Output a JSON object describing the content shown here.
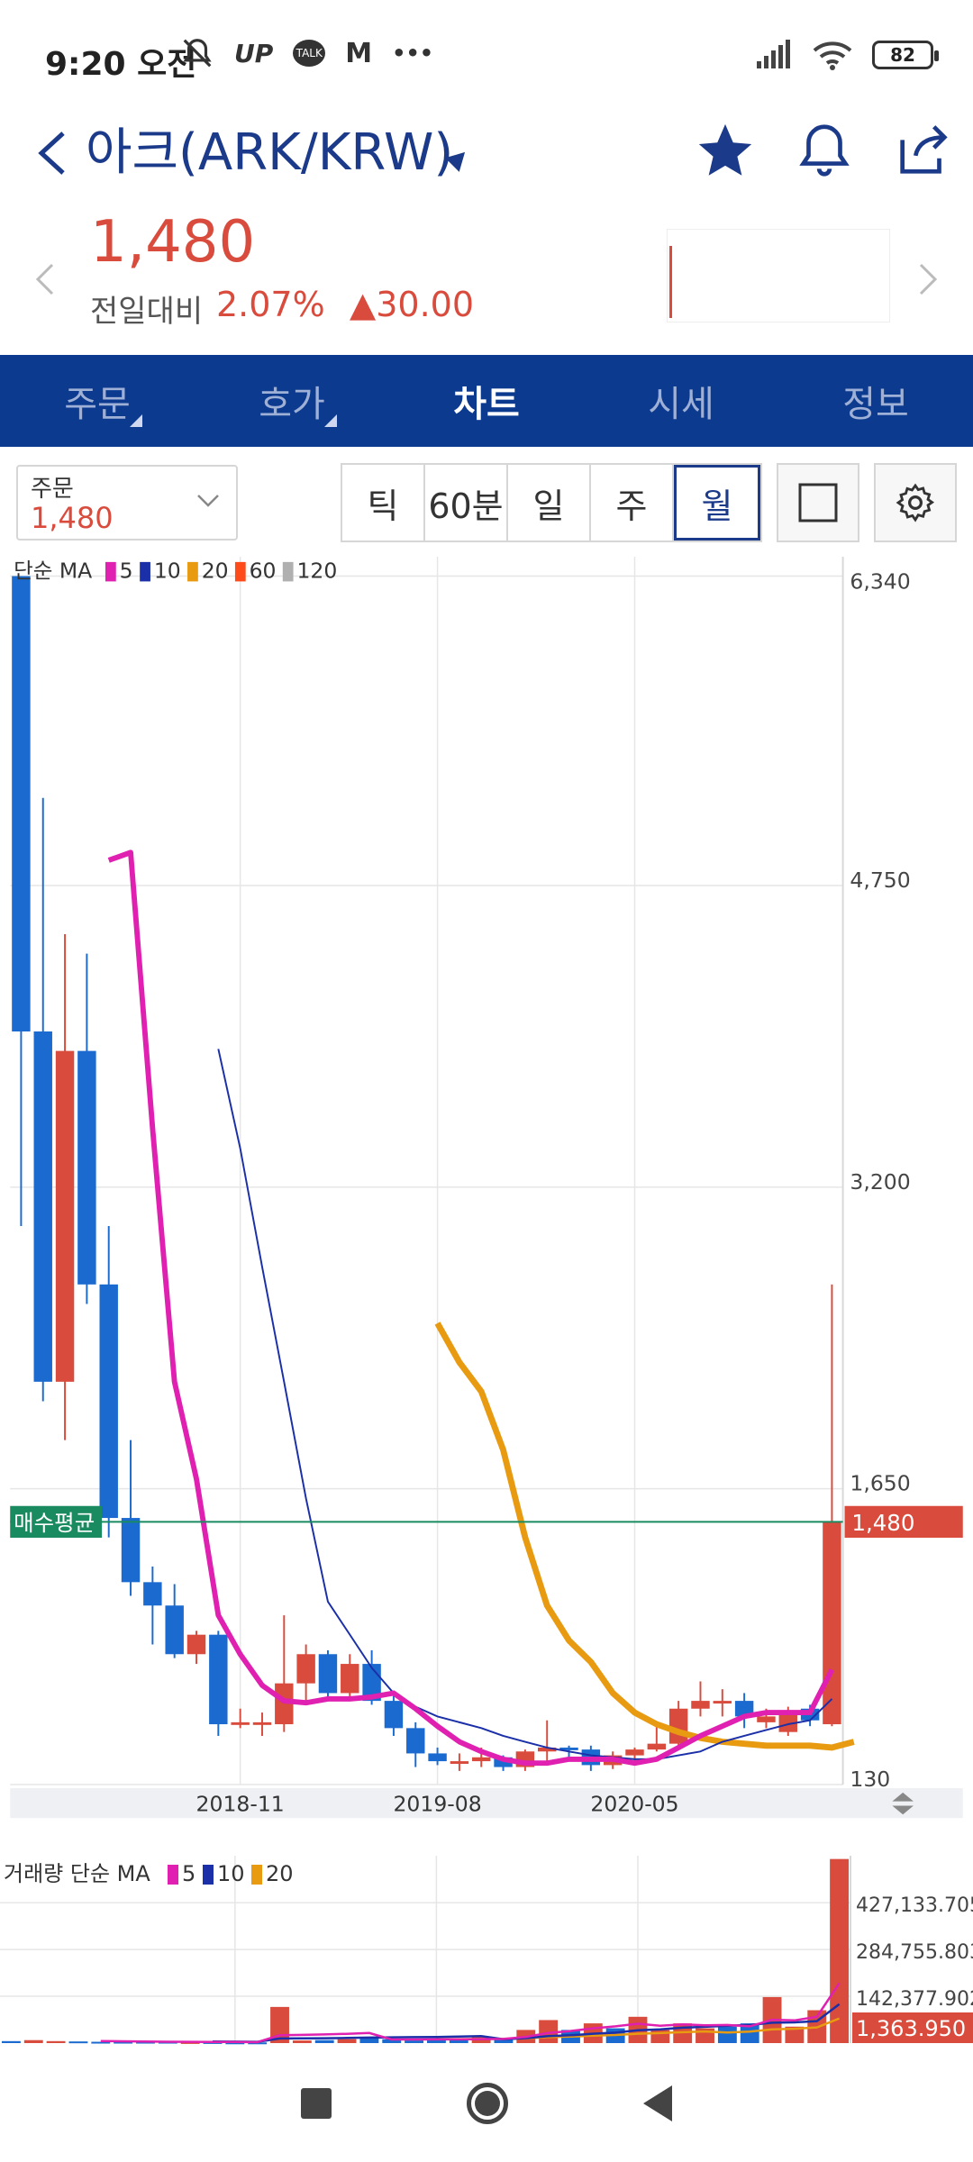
{
  "status_bar": {
    "time": "9:20 오전",
    "icons": [
      "bell-off-icon",
      "up-icon",
      "talk-icon",
      "m-icon",
      "more-icon"
    ],
    "icon_text_up": "UP",
    "icon_text_talk": "TALK",
    "icon_text_m": "M",
    "icon_text_more": "•••",
    "battery": "82"
  },
  "header": {
    "title": "아크(ARK/KRW)"
  },
  "price": {
    "current": "1,480",
    "change_label": "전일대비",
    "change_pct": "2.07%",
    "change_amt": "▲30.00",
    "color_up": "#d94b3c"
  },
  "tabs": [
    {
      "label": "주문"
    },
    {
      "label": "호가"
    },
    {
      "label": "차트"
    },
    {
      "label": "시세"
    },
    {
      "label": "정보"
    }
  ],
  "toolbar": {
    "order_label": "주문",
    "order_value": "1,480",
    "periods": [
      "틱",
      "60분",
      "일",
      "주",
      "월"
    ],
    "selected_period": "월"
  },
  "chart_data": [
    {
      "type": "candlestick",
      "legend": {
        "title": "단순 MA",
        "items": [
          {
            "label": "5",
            "color": "#e020b0"
          },
          {
            "label": "10",
            "color": "#1a2fa8"
          },
          {
            "label": "20",
            "color": "#e89a10"
          },
          {
            "label": "60",
            "color": "#ff4a1a"
          },
          {
            "label": "120",
            "color": "#b0b0b0"
          }
        ]
      },
      "y_ticks": [
        "6,340",
        "4,750",
        "3,200",
        "1,650",
        "130"
      ],
      "ylim": [
        130,
        6340
      ],
      "x_ticks": [
        {
          "label": "2018-11",
          "index": 10
        },
        {
          "label": "2019-08",
          "index": 19
        },
        {
          "label": "2020-05",
          "index": 28
        }
      ],
      "avg_buy_label": "매수평균",
      "current_price_label": "1,480",
      "current_price": 1480,
      "colors": {
        "up": "#d94b3c",
        "down": "#1a6ad0",
        "avg_line": "#1a8a60"
      },
      "candles": [
        {
          "o": 6340,
          "h": 6340,
          "l": 3000,
          "c": 4000
        },
        {
          "o": 4000,
          "h": 5200,
          "l": 2100,
          "c": 2200
        },
        {
          "o": 2200,
          "h": 4500,
          "l": 1900,
          "c": 3900
        },
        {
          "o": 3900,
          "h": 4400,
          "l": 2600,
          "c": 2700
        },
        {
          "o": 2700,
          "h": 3000,
          "l": 1400,
          "c": 1500
        },
        {
          "o": 1500,
          "h": 1900,
          "l": 1100,
          "c": 1170
        },
        {
          "o": 1170,
          "h": 1250,
          "l": 850,
          "c": 1050
        },
        {
          "o": 1050,
          "h": 1160,
          "l": 780,
          "c": 800
        },
        {
          "o": 800,
          "h": 920,
          "l": 750,
          "c": 900
        },
        {
          "o": 900,
          "h": 920,
          "l": 380,
          "c": 440
        },
        {
          "o": 440,
          "h": 520,
          "l": 420,
          "c": 450
        },
        {
          "o": 450,
          "h": 500,
          "l": 380,
          "c": 450
        },
        {
          "o": 440,
          "h": 1000,
          "l": 400,
          "c": 650
        },
        {
          "o": 650,
          "h": 850,
          "l": 550,
          "c": 800
        },
        {
          "o": 800,
          "h": 820,
          "l": 570,
          "c": 600
        },
        {
          "o": 600,
          "h": 800,
          "l": 580,
          "c": 750
        },
        {
          "o": 750,
          "h": 820,
          "l": 540,
          "c": 560
        },
        {
          "o": 560,
          "h": 600,
          "l": 380,
          "c": 420
        },
        {
          "o": 420,
          "h": 450,
          "l": 220,
          "c": 290
        },
        {
          "o": 290,
          "h": 320,
          "l": 230,
          "c": 250
        },
        {
          "o": 250,
          "h": 290,
          "l": 200,
          "c": 250
        },
        {
          "o": 250,
          "h": 320,
          "l": 220,
          "c": 270
        },
        {
          "o": 270,
          "h": 280,
          "l": 200,
          "c": 220
        },
        {
          "o": 220,
          "h": 310,
          "l": 200,
          "c": 300
        },
        {
          "o": 300,
          "h": 460,
          "l": 250,
          "c": 320
        },
        {
          "o": 320,
          "h": 330,
          "l": 260,
          "c": 310
        },
        {
          "o": 310,
          "h": 330,
          "l": 200,
          "c": 230
        },
        {
          "o": 230,
          "h": 300,
          "l": 210,
          "c": 280
        },
        {
          "o": 280,
          "h": 320,
          "l": 250,
          "c": 310
        },
        {
          "o": 310,
          "h": 440,
          "l": 300,
          "c": 340
        },
        {
          "o": 340,
          "h": 560,
          "l": 320,
          "c": 520
        },
        {
          "o": 520,
          "h": 660,
          "l": 480,
          "c": 560
        },
        {
          "o": 560,
          "h": 620,
          "l": 480,
          "c": 560
        },
        {
          "o": 560,
          "h": 600,
          "l": 420,
          "c": 480
        },
        {
          "o": 450,
          "h": 520,
          "l": 420,
          "c": 480
        },
        {
          "o": 400,
          "h": 530,
          "l": 380,
          "c": 500
        },
        {
          "o": 520,
          "h": 540,
          "l": 430,
          "c": 460
        },
        {
          "o": 440,
          "h": 2700,
          "l": 430,
          "c": 1480
        }
      ],
      "ma5": [
        null,
        null,
        null,
        null,
        4880,
        4920,
        3500,
        2200,
        1700,
        1000,
        800,
        640,
        560,
        550,
        570,
        570,
        580,
        600,
        520,
        430,
        350,
        300,
        260,
        240,
        240,
        260,
        260,
        260,
        240,
        260,
        320,
        380,
        430,
        480,
        500,
        500,
        500,
        720
      ],
      "ma10": [
        null,
        null,
        null,
        null,
        null,
        null,
        null,
        null,
        null,
        3910,
        3400,
        2790,
        2200,
        1600,
        1070,
        900,
        730,
        600,
        530,
        480,
        450,
        420,
        380,
        350,
        320,
        300,
        280,
        270,
        260,
        260,
        280,
        300,
        350,
        380,
        410,
        440,
        460,
        570
      ],
      "ma20": [
        null,
        null,
        null,
        null,
        null,
        null,
        null,
        null,
        null,
        null,
        null,
        null,
        null,
        null,
        null,
        null,
        null,
        null,
        null,
        2500,
        2300,
        2150,
        1850,
        1400,
        1050,
        870,
        760,
        600,
        500,
        440,
        400,
        370,
        350,
        340,
        330,
        330,
        330,
        320,
        350
      ]
    },
    {
      "type": "bar",
      "legend": {
        "title": "거래량 단순 MA",
        "items": [
          {
            "label": "5",
            "color": "#e020b0"
          },
          {
            "label": "10",
            "color": "#1a2fa8"
          },
          {
            "label": "20",
            "color": "#e89a10"
          }
        ]
      },
      "y_ticks": [
        "427,133.705",
        "284,755.803",
        "142,377.902"
      ],
      "current_value_label": "1,363.950",
      "ylim": [
        0,
        570000
      ],
      "values": [
        6000,
        9000,
        6000,
        5000,
        4000,
        4000,
        4000,
        4000,
        3000,
        3000,
        2000,
        2000,
        110000,
        8000,
        9000,
        12000,
        14000,
        12000,
        8000,
        10000,
        12000,
        18000,
        15000,
        40000,
        70000,
        40000,
        60000,
        45000,
        80000,
        40000,
        60000,
        45000,
        50000,
        60000,
        140000,
        50000,
        100000,
        560000
      ],
      "up_flags": [
        false,
        true,
        true,
        false,
        false,
        false,
        false,
        false,
        true,
        false,
        false,
        false,
        true,
        true,
        false,
        true,
        false,
        false,
        false,
        false,
        false,
        true,
        false,
        true,
        true,
        false,
        true,
        false,
        true,
        true,
        true,
        true,
        false,
        false,
        true,
        true,
        true,
        true
      ]
    }
  ],
  "nav": {
    "icons": [
      "recent-apps-icon",
      "home-icon",
      "back-icon"
    ]
  }
}
